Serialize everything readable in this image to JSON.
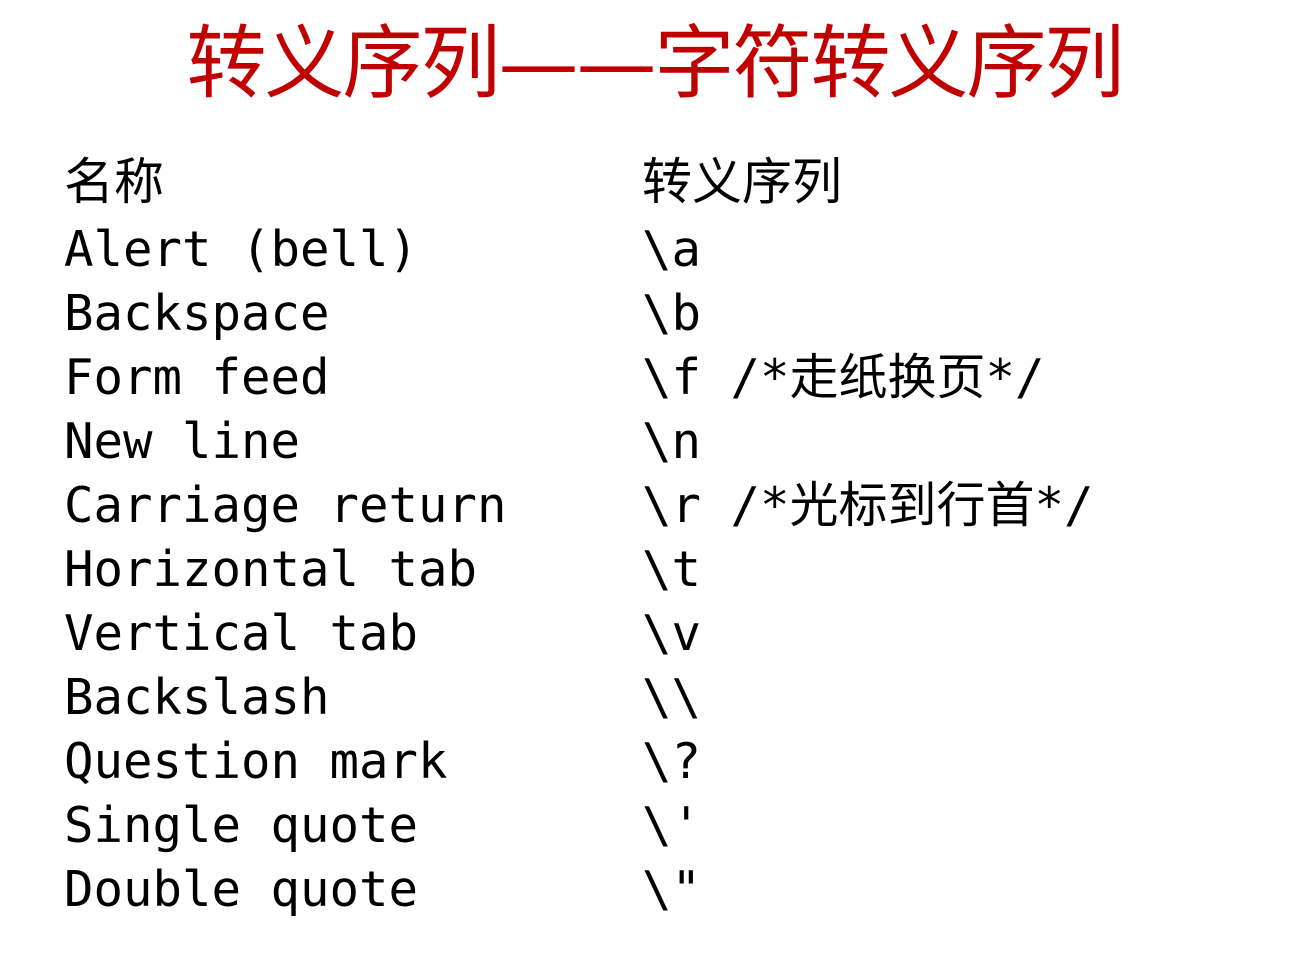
{
  "title": "转义序列——字符转义序列",
  "columns": {
    "name": "名称",
    "sequence": "转义序列"
  },
  "rows": [
    {
      "name": "Alert (bell)",
      "sequence": "\\a"
    },
    {
      "name": "Backspace",
      "sequence": "\\b"
    },
    {
      "name": "Form feed",
      "sequence": "\\f /*走纸换页*/"
    },
    {
      "name": "New line",
      "sequence": "\\n"
    },
    {
      "name": "Carriage return",
      "sequence": "\\r /*光标到行首*/"
    },
    {
      "name": "Horizontal tab",
      "sequence": "\\t"
    },
    {
      "name": "Vertical tab",
      "sequence": "\\v"
    },
    {
      "name": "Backslash",
      "sequence": "\\\\"
    },
    {
      "name": "Question mark",
      "sequence": "\\?"
    },
    {
      "name": "Single quote",
      "sequence": "\\'"
    },
    {
      "name": "Double quote",
      "sequence": "\\\""
    }
  ],
  "colors": {
    "title": "#c00000",
    "text": "#000000",
    "background": "#ffffff"
  }
}
